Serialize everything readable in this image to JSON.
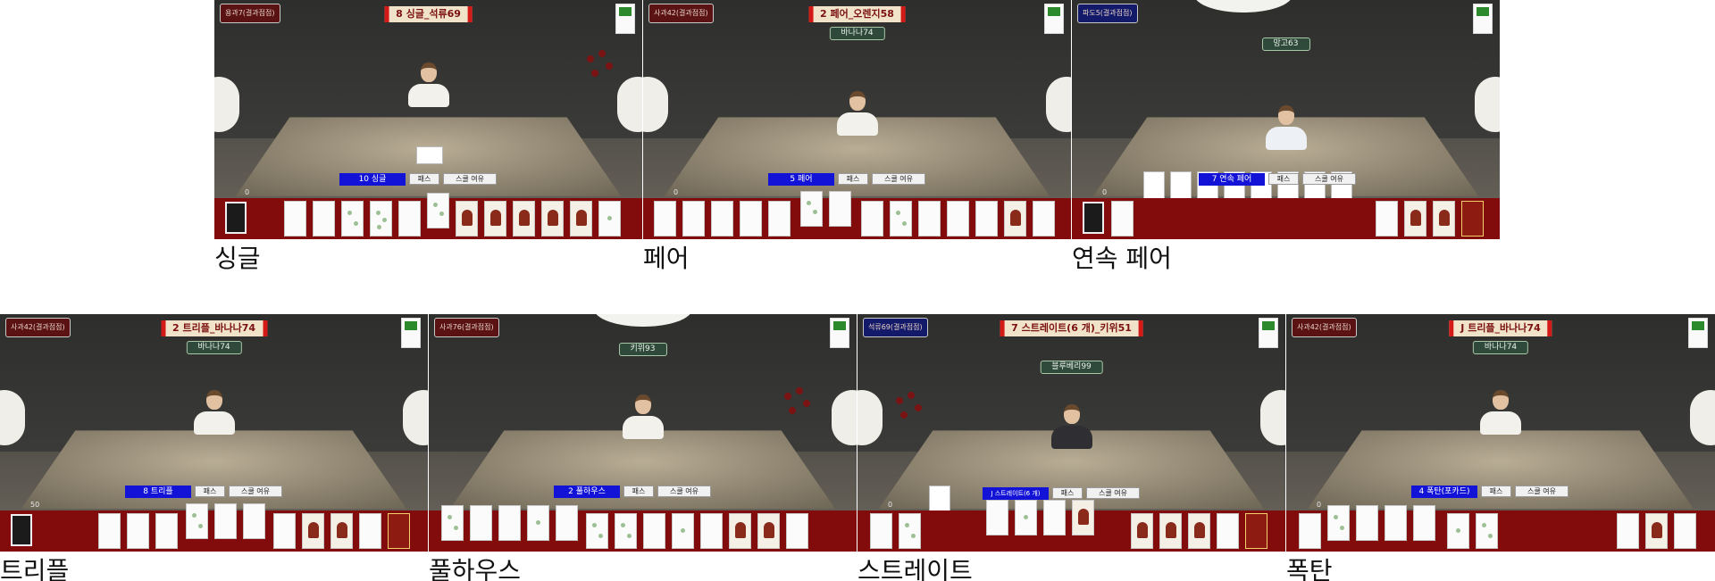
{
  "panels": [
    {
      "caption": "싱글",
      "title": "8 싱글_석류69",
      "hud": "용과7(결과점점)",
      "player_tag": "",
      "play_label": "10 싱글",
      "pass_label": "패스",
      "style_label": "스쿨 여유",
      "card_count": "0"
    },
    {
      "caption": "페어",
      "title": "2 페어_오렌지58",
      "hud": "사과42(결과점점)",
      "player_tag": "바나나74",
      "play_label": "5 페어",
      "pass_label": "패스",
      "style_label": "스쿨 여유",
      "card_count": "0"
    },
    {
      "caption": "연속 페어",
      "title": "",
      "hud": "파도5(결과점점)",
      "player_tag": "망고63",
      "play_label": "7 연속 페어",
      "pass_label": "패스",
      "style_label": "스쿨 여유",
      "card_count": "0"
    },
    {
      "caption": "트리플",
      "title": "2 트리플_바나나74",
      "hud": "사과42(결과점점)",
      "player_tag": "바나나74",
      "play_label": "8 트리플",
      "pass_label": "패스",
      "style_label": "스쿨 여유",
      "card_count": "50"
    },
    {
      "caption": "풀하우스",
      "title": "",
      "hud": "사과76(결과점점)",
      "player_tag": "키위93",
      "play_label": "2 풀하우스",
      "pass_label": "패스",
      "style_label": "스쿨 여유",
      "card_count": ""
    },
    {
      "caption": "스트레이트",
      "title": "7 스트레이트(6 개)_키위51",
      "hud": "석류69(결과점점)",
      "player_tag": "블루베리99",
      "play_label": "J 스트레이트(6 개)",
      "pass_label": "패스",
      "style_label": "스쿨 여유",
      "card_count": "0"
    },
    {
      "caption": "폭탄",
      "title": "J 트리플_바나나74",
      "hud": "사과42(결과점점)",
      "player_tag": "바나나74",
      "play_label": "4 폭탄(포카드)",
      "pass_label": "패스",
      "style_label": "스쿨 여유",
      "card_count": "0"
    }
  ],
  "colors": {
    "card_bar": "#820c0c",
    "play_label_bg": "#1213d6",
    "banner_border": "#d31a17",
    "player_tag_bg": "#2f4a3a"
  },
  "icons": {
    "battery": "battery-icon",
    "deck": "deck-card-icon"
  }
}
